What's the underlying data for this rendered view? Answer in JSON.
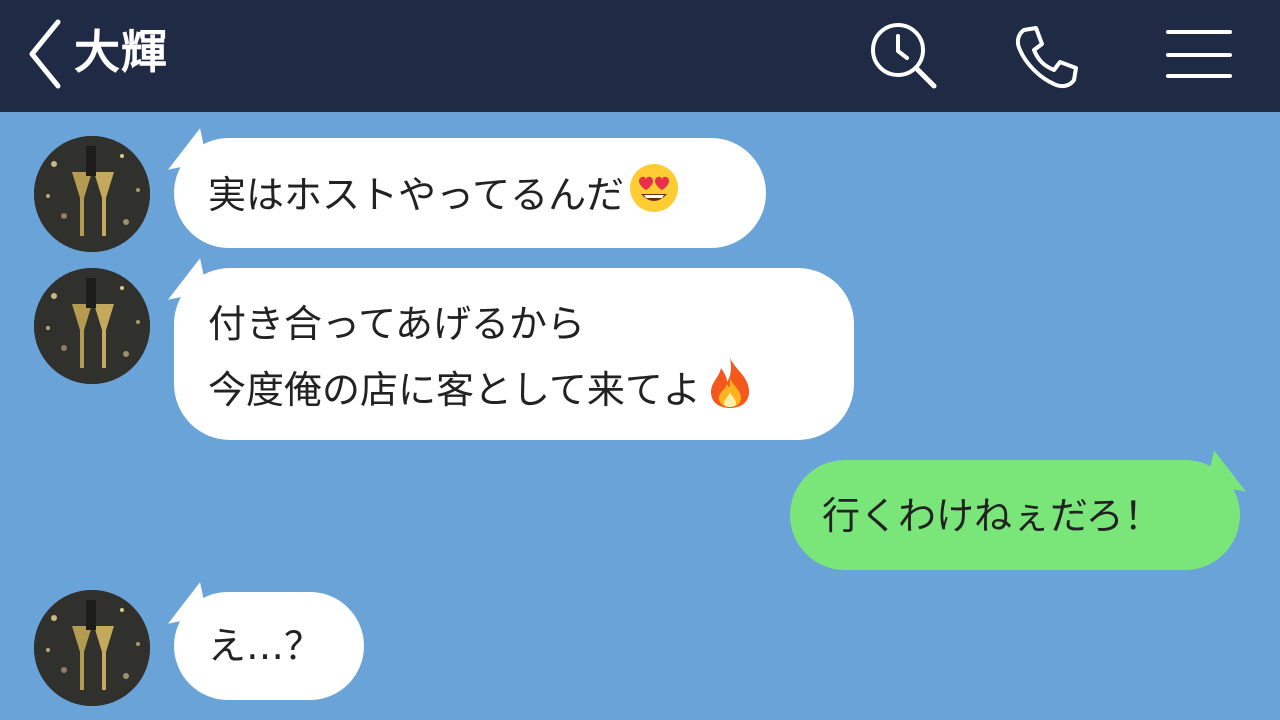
{
  "header": {
    "title": "大輝",
    "back_icon": "chevron-left-icon",
    "icons": [
      "search-history-icon",
      "phone-icon",
      "hamburger-menu-icon"
    ]
  },
  "colors": {
    "header_bg": "#1f2a44",
    "chat_bg": "#6aa3d8",
    "incoming_bubble": "#ffffff",
    "outgoing_bubble": "#7ae67a"
  },
  "messages": [
    {
      "sender": "contact",
      "lines": [
        "実はホストやってるんだ"
      ],
      "emoji": "heart-eyes-emoji"
    },
    {
      "sender": "contact",
      "lines": [
        "付き合ってあげるから",
        "今度俺の店に客として来てよ"
      ],
      "emoji": "fire-emoji"
    },
    {
      "sender": "me",
      "lines": [
        "行くわけねぇだろ！"
      ],
      "emoji": ""
    },
    {
      "sender": "contact",
      "lines": [
        "え…？"
      ],
      "emoji": ""
    }
  ]
}
